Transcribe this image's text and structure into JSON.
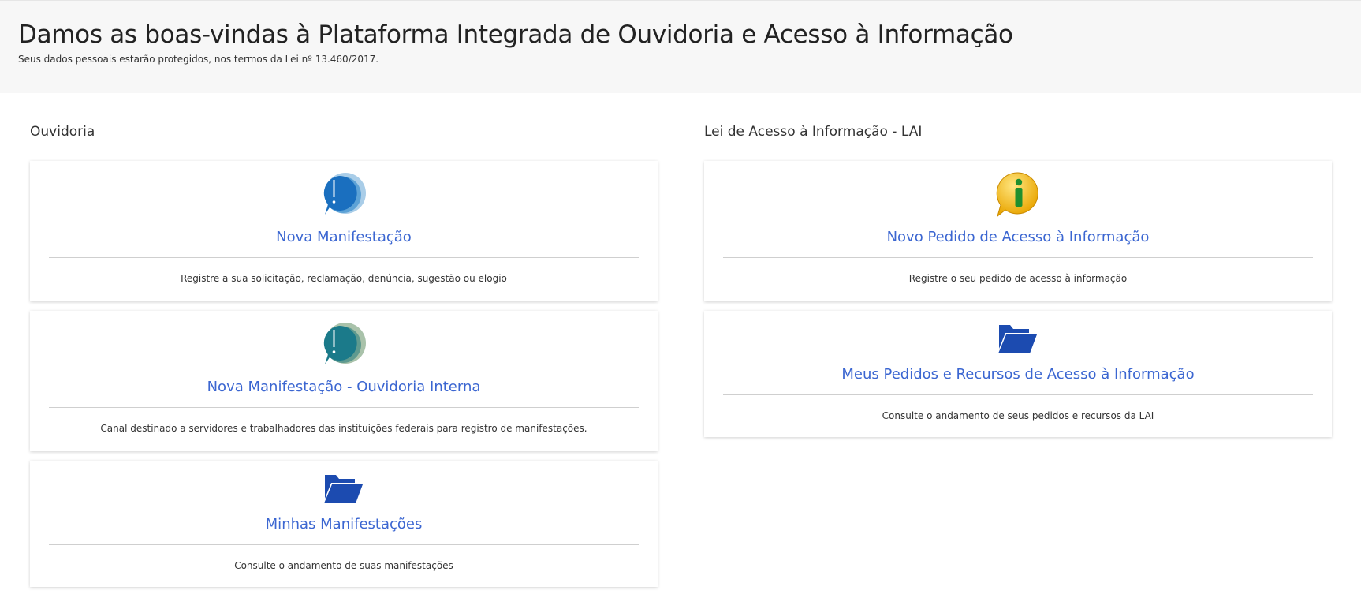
{
  "header": {
    "title": "Damos as boas-vindas à Plataforma Integrada de Ouvidoria e Acesso à Informação",
    "subtitle": "Seus dados pessoais estarão protegidos, nos termos da Lei nº 13.460/2017."
  },
  "ouvidoria": {
    "title": "Ouvidoria",
    "cards": [
      {
        "icon": "speech-bubble-exclamation-blue-icon",
        "label": "Nova Manifestação",
        "description": "Registre a sua solicitação, reclamação, denúncia, sugestão ou elogio"
      },
      {
        "icon": "speech-bubble-exclamation-teal-icon",
        "label": "Nova Manifestação - Ouvidoria Interna",
        "description": "Canal destinado a servidores e trabalhadores das instituições federais para registro de manifestações."
      },
      {
        "icon": "folder-open-icon",
        "label": "Minhas Manifestações",
        "description": "Consulte o andamento de suas manifestações"
      }
    ]
  },
  "lai": {
    "title": "Lei de Acesso à Informação - LAI",
    "cards": [
      {
        "icon": "info-bubble-icon",
        "label": "Novo Pedido de Acesso à Informação",
        "description": "Registre o seu pedido de acesso à informação"
      },
      {
        "icon": "folder-open-icon",
        "label": "Meus Pedidos e Recursos de Acesso à Informação",
        "description": "Consulte o andamento de seus pedidos e recursos da LAI"
      }
    ]
  },
  "colors": {
    "link": "#3b66d1",
    "bubble_blue": "#1a6fbf",
    "bubble_teal": "#1b7a8a",
    "folder_blue": "#1c4bb0",
    "info_yellow": "#f2b90f",
    "info_green": "#1f8f2e"
  }
}
